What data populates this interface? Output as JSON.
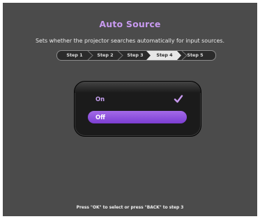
{
  "header": {
    "title": "Auto Source",
    "subtitle": "Sets whether the projector searches automatically for input sources."
  },
  "steps": [
    {
      "label": "Step 1",
      "current": false
    },
    {
      "label": "Step 2",
      "current": false
    },
    {
      "label": "Step 3",
      "current": false
    },
    {
      "label": "Step 4",
      "current": true
    },
    {
      "label": "Step 5",
      "current": false
    }
  ],
  "options": {
    "on_label": "On",
    "off_label": "Off",
    "checked": "On",
    "highlighted": "Off",
    "check_icon": "checkmark-icon"
  },
  "footer": {
    "hint": "Press \"OK\" to select or press \"BACK\" to step 3"
  },
  "colors": {
    "accent": "#c89af0",
    "highlight": "#8b4fdc",
    "background": "#4b4b4b"
  }
}
